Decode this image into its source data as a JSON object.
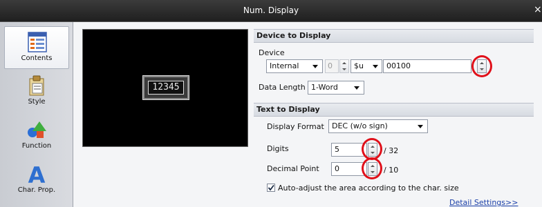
{
  "window": {
    "title": "Num. Display",
    "close_glyph": "×"
  },
  "sidebar": {
    "items": [
      {
        "label": "Contents",
        "icon": "contents-icon"
      },
      {
        "label": "Style",
        "icon": "style-icon"
      },
      {
        "label": "Function",
        "icon": "function-icon"
      },
      {
        "label": "Char. Prop.",
        "icon": "char-prop-icon"
      }
    ]
  },
  "preview": {
    "value": "12345"
  },
  "device_section": {
    "header": "Device to Display",
    "device_label": "Device",
    "memory_type": "Internal",
    "station": "0",
    "register_type": "$u",
    "address": "00100",
    "data_length_label": "Data Length",
    "data_length": "1-Word"
  },
  "text_section": {
    "header": "Text to Display",
    "display_format_label": "Display Format",
    "display_format": "DEC (w/o sign)",
    "digits_label": "Digits",
    "digits": "5",
    "digits_max": "/ 32",
    "decimal_label": "Decimal Point",
    "decimal": "0",
    "decimal_max": "/ 10",
    "auto_adjust_label": "Auto-adjust the area according to the char. size",
    "auto_adjust_checked": true,
    "detail_link": "Detail Settings>>"
  },
  "colors": {
    "highlight_ring": "#e0101a",
    "link": "#1a3fa8"
  }
}
